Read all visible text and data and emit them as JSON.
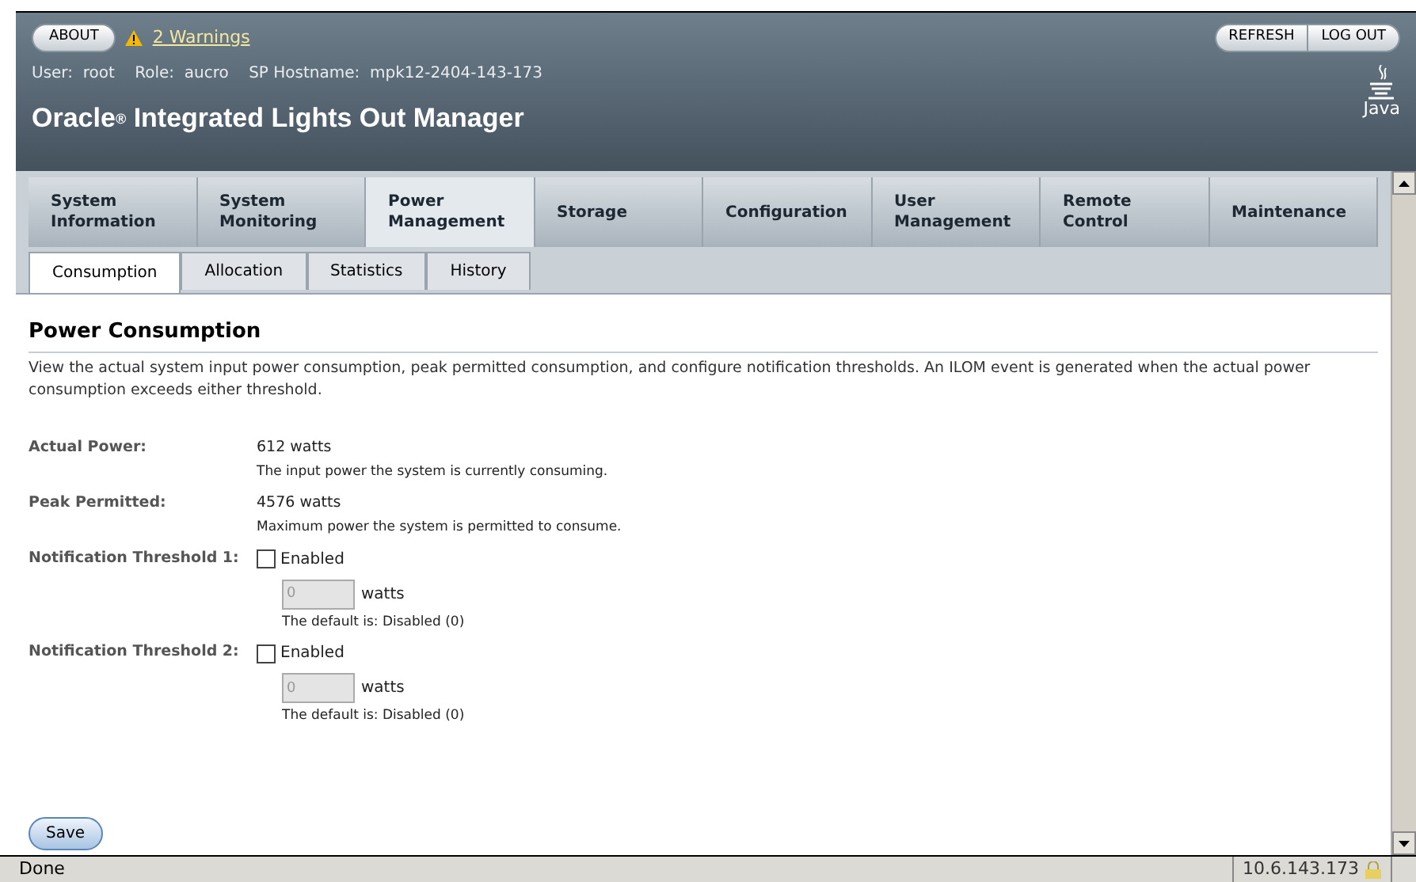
{
  "header": {
    "about": "ABOUT",
    "warnings": "2 Warnings",
    "user_info": "User:  root    Role:  aucro    SP Hostname:  mpk12-2404-143-173",
    "title_brand": "Oracle",
    "title_mark": "®",
    "title_rest": "Integrated Lights Out Manager",
    "buttons": [
      "REFRESH",
      "LOG OUT"
    ],
    "logo_text": "Java"
  },
  "tabs": [
    {
      "label": "System\nInformation",
      "selected": false
    },
    {
      "label": "System\nMonitoring",
      "selected": false
    },
    {
      "label": "Power\nManagement",
      "selected": true
    },
    {
      "label": "Storage",
      "selected": false
    },
    {
      "label": "Configuration",
      "selected": false
    },
    {
      "label": "User\nManagement",
      "selected": false
    },
    {
      "label": "Remote\nControl",
      "selected": false
    },
    {
      "label": "Maintenance",
      "selected": false
    }
  ],
  "subtabs": [
    {
      "label": "Consumption",
      "selected": true
    },
    {
      "label": "Allocation",
      "selected": false
    },
    {
      "label": "Statistics",
      "selected": false
    },
    {
      "label": "History",
      "selected": false
    }
  ],
  "page_title": "Power Consumption",
  "description": "View the actual system input power consumption, peak permitted consumption, and configure notification thresholds. An ILOM event is generated when the actual power consumption exceeds either threshold.",
  "fields": [
    {
      "kind": "info",
      "label": "Actual Power:",
      "value": "612 watts",
      "help": "The input power the system is currently consuming."
    },
    {
      "kind": "info",
      "label": "Peak Permitted:",
      "value": "4576 watts",
      "help": "Maximum power the system is permitted to consume."
    },
    {
      "kind": "threshold",
      "label": "Notification Threshold 1:",
      "checkbox_label": "Enabled",
      "checked": false,
      "input_value": "0",
      "unit": "watts",
      "help": "The default is: Disabled (0)"
    },
    {
      "kind": "threshold",
      "label": "Notification Threshold 2:",
      "checkbox_label": "Enabled",
      "checked": false,
      "input_value": "0",
      "unit": "watts",
      "help": "The default is: Disabled (0)"
    }
  ],
  "save_button": "Save",
  "status_bar": {
    "text": "Done",
    "host": "10.6.143.173"
  }
}
